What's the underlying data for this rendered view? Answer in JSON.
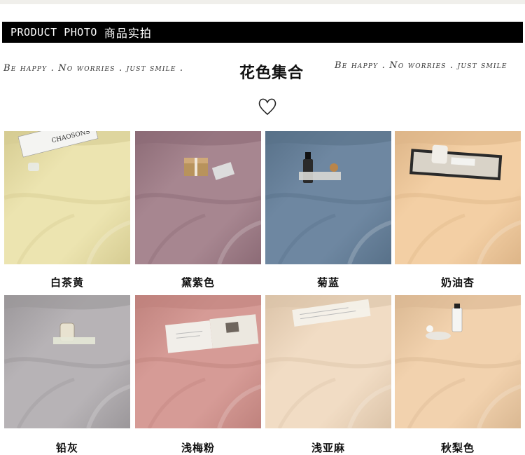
{
  "header": {
    "banner_en": "PRODUCT PHOTO",
    "banner_cn": "商品实拍"
  },
  "tagline_left": "Be happy . No worries . just smile .",
  "tagline_right": "Be happy . No worries . just smile",
  "section_title": "花色集合",
  "products": [
    {
      "name": "白茶黄",
      "color": "#ece4b0",
      "shade": "#d6cc92",
      "prop": "magazine"
    },
    {
      "name": "黛紫色",
      "color": "#a78690",
      "shade": "#8c6b76",
      "prop": "giftbox"
    },
    {
      "name": "菊蓝",
      "color": "#6e87a1",
      "shade": "#587189",
      "prop": "bottle"
    },
    {
      "name": "奶油杏",
      "color": "#f3cfa4",
      "shade": "#ddb588",
      "prop": "tray"
    },
    {
      "name": "铅灰",
      "color": "#b7b3b6",
      "shade": "#9b979a",
      "prop": "candle"
    },
    {
      "name": "浅梅粉",
      "color": "#d69b96",
      "shade": "#bf827d",
      "prop": "book"
    },
    {
      "name": "浅亚麻",
      "color": "#f1dcc4",
      "shade": "#dbc3a8",
      "prop": "paper"
    },
    {
      "name": "秋梨色",
      "color": "#f2d2ae",
      "shade": "#dab892",
      "prop": "perfume"
    }
  ]
}
